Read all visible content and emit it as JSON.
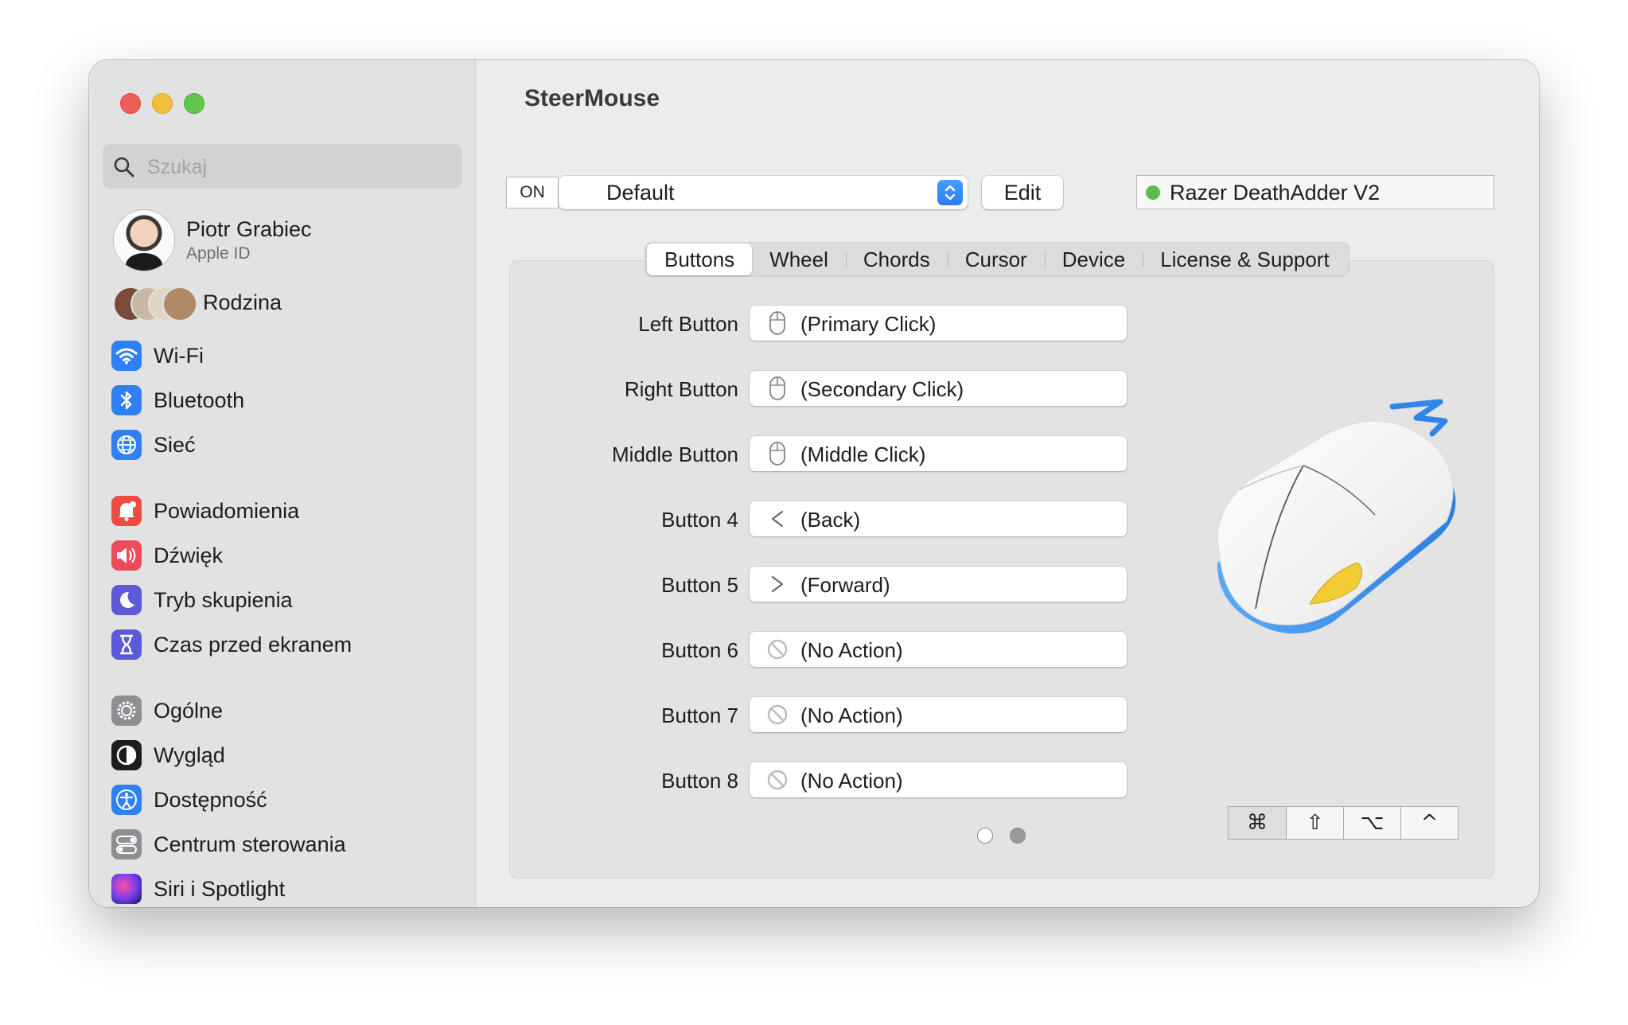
{
  "sidebar": {
    "search_placeholder": "Szukaj",
    "profile": {
      "name": "Piotr Grabiec",
      "subtitle": "Apple ID"
    },
    "family_label": "Rodzina",
    "items": [
      {
        "label": "Wi-Fi",
        "icon": "wifi-icon",
        "color": "#2f7ff5"
      },
      {
        "label": "Bluetooth",
        "icon": "bluetooth-icon",
        "color": "#2f7ff5"
      },
      {
        "label": "Sieć",
        "icon": "globe-icon",
        "color": "#2f7ff5"
      },
      {
        "label": "Powiadomienia",
        "icon": "bell-icon",
        "color": "#ee4b45"
      },
      {
        "label": "Dźwięk",
        "icon": "speaker-icon",
        "color": "#ee4b5a"
      },
      {
        "label": "Tryb skupienia",
        "icon": "moon-icon",
        "color": "#5c5ad8"
      },
      {
        "label": "Czas przed ekranem",
        "icon": "hourglass-icon",
        "color": "#5c5ad8"
      },
      {
        "label": "Ogólne",
        "icon": "gear-icon",
        "color": "#8e8e93"
      },
      {
        "label": "Wygląd",
        "icon": "appearance-icon",
        "color": "#1d1d1f"
      },
      {
        "label": "Dostępność",
        "icon": "accessibility-icon",
        "color": "#2f7ff5"
      },
      {
        "label": "Centrum sterowania",
        "icon": "toggles-icon",
        "color": "#8e8e93"
      },
      {
        "label": "Siri i Spotlight",
        "icon": "siri-icon",
        "color": "#3b1e6e"
      }
    ]
  },
  "main": {
    "title": "SteerMouse",
    "toolbar": {
      "on_label": "ON",
      "profile_value": "Default",
      "edit_label": "Edit",
      "device_name": "Razer DeathAdder V2",
      "device_status_color": "#58c04a"
    },
    "tabs": [
      {
        "label": "Buttons",
        "active": true
      },
      {
        "label": "Wheel",
        "active": false
      },
      {
        "label": "Chords",
        "active": false
      },
      {
        "label": "Cursor",
        "active": false
      },
      {
        "label": "Device",
        "active": false
      },
      {
        "label": "License & Support",
        "active": false
      }
    ],
    "buttons": [
      {
        "label": "Left Button",
        "action": "(Primary Click)",
        "icon": "mouse-icon"
      },
      {
        "label": "Right Button",
        "action": "(Secondary Click)",
        "icon": "mouse-icon"
      },
      {
        "label": "Middle Button",
        "action": "(Middle Click)",
        "icon": "mouse-icon"
      },
      {
        "label": "Button 4",
        "action": "(Back)",
        "icon": "chevron-left-icon"
      },
      {
        "label": "Button 5",
        "action": "(Forward)",
        "icon": "chevron-right-icon"
      },
      {
        "label": "Button 6",
        "action": "(No Action)",
        "icon": "no-action-icon"
      },
      {
        "label": "Button 7",
        "action": "(No Action)",
        "icon": "no-action-icon"
      },
      {
        "label": "Button 8",
        "action": "(No Action)",
        "icon": "no-action-icon"
      }
    ],
    "pager": {
      "pages": 2,
      "current": 1
    },
    "modifiers": [
      "⌘",
      "⇧",
      "⌥",
      "^"
    ]
  }
}
